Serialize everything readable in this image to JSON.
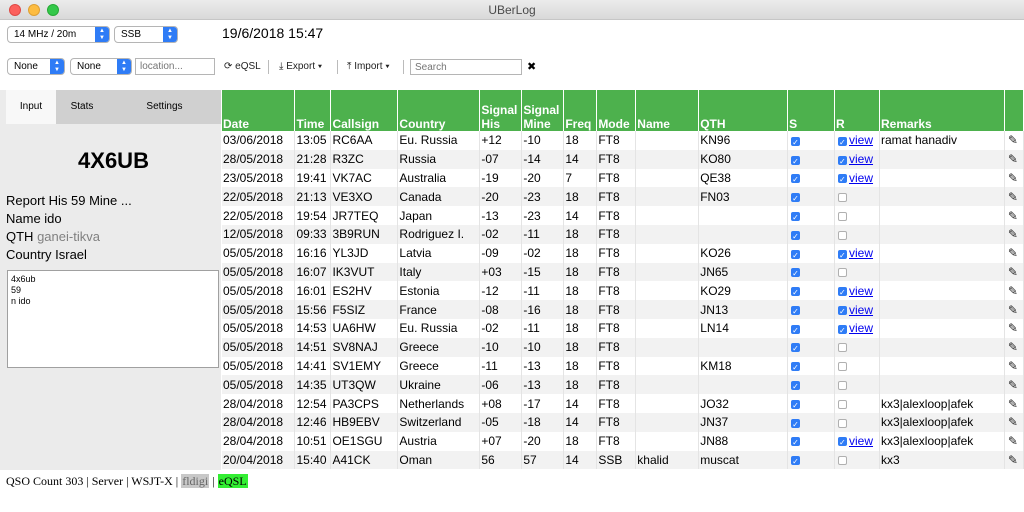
{
  "window": {
    "title": "UBerLog"
  },
  "toolbar": {
    "band": "14 MHz / 20m",
    "mode": "SSB",
    "datetime": "19/6/2018 15:47",
    "filter1": "None",
    "filter2": "None",
    "location_placeholder": "location...",
    "eqsl_label": "eQSL",
    "export_label": "Export",
    "import_label": "Import",
    "search_placeholder": "Search"
  },
  "tabs": [
    "Input",
    "Stats",
    "Settings"
  ],
  "input": {
    "callsign": "4X6UB",
    "report_line": "Report His 59 Mine ...",
    "name_line": "Name ido",
    "qth_label": "QTH",
    "qth_value": "ganei-tikva",
    "country_line": "Country Israel",
    "memo": "4x6ub\n59\nn ido"
  },
  "table": {
    "headers": [
      "Date",
      "Time",
      "Callsign",
      "Country",
      "Signal His",
      "Signal Mine",
      "Freq",
      "Mode",
      "Name",
      "QTH",
      "S",
      "R",
      "Remarks",
      ""
    ],
    "view_label": "view",
    "rows": [
      [
        "03/06/2018",
        "13:05",
        "RC6AA",
        "Eu. Russia",
        "+12",
        "-10",
        "18",
        "FT8",
        "",
        "KN96",
        true,
        true,
        "ramat hanadiv"
      ],
      [
        "28/05/2018",
        "21:28",
        "R3ZC",
        "Russia",
        "-07",
        "-14",
        "14",
        "FT8",
        "",
        "KO80",
        true,
        true,
        ""
      ],
      [
        "23/05/2018",
        "19:41",
        "VK7AC",
        "Australia",
        "-19",
        "-20",
        "7",
        "FT8",
        "",
        "QE38",
        true,
        true,
        ""
      ],
      [
        "22/05/2018",
        "21:13",
        "VE3XO",
        "Canada",
        "-20",
        "-23",
        "18",
        "FT8",
        "",
        "FN03",
        true,
        false,
        ""
      ],
      [
        "22/05/2018",
        "19:54",
        "JR7TEQ",
        "Japan",
        "-13",
        "-23",
        "14",
        "FT8",
        "",
        "",
        true,
        false,
        ""
      ],
      [
        "12/05/2018",
        "09:33",
        "3B9RUN",
        "Rodriguez I.",
        "-02",
        "-11",
        "18",
        "FT8",
        "",
        "",
        true,
        false,
        ""
      ],
      [
        "05/05/2018",
        "16:16",
        "YL3JD",
        "Latvia",
        "-09",
        "-02",
        "18",
        "FT8",
        "",
        "KO26",
        true,
        true,
        ""
      ],
      [
        "05/05/2018",
        "16:07",
        "IK3VUT",
        "Italy",
        "+03",
        "-15",
        "18",
        "FT8",
        "",
        "JN65",
        true,
        false,
        ""
      ],
      [
        "05/05/2018",
        "16:01",
        "ES2HV",
        "Estonia",
        "-12",
        "-11",
        "18",
        "FT8",
        "",
        "KO29",
        true,
        true,
        ""
      ],
      [
        "05/05/2018",
        "15:56",
        "F5SIZ",
        "France",
        "-08",
        "-16",
        "18",
        "FT8",
        "",
        "JN13",
        true,
        true,
        ""
      ],
      [
        "05/05/2018",
        "14:53",
        "UA6HW",
        "Eu. Russia",
        "-02",
        "-11",
        "18",
        "FT8",
        "",
        "LN14",
        true,
        true,
        ""
      ],
      [
        "05/05/2018",
        "14:51",
        "SV8NAJ",
        "Greece",
        "-10",
        "-10",
        "18",
        "FT8",
        "",
        "",
        true,
        false,
        ""
      ],
      [
        "05/05/2018",
        "14:41",
        "SV1EMY",
        "Greece",
        "-11",
        "-13",
        "18",
        "FT8",
        "",
        "KM18",
        true,
        false,
        ""
      ],
      [
        "05/05/2018",
        "14:35",
        "UT3QW",
        "Ukraine",
        "-06",
        "-13",
        "18",
        "FT8",
        "",
        "",
        true,
        false,
        ""
      ],
      [
        "28/04/2018",
        "12:54",
        "PA3CPS",
        "Netherlands",
        "+08",
        "-17",
        "14",
        "FT8",
        "",
        "JO32",
        true,
        false,
        "kx3|alexloop|afek"
      ],
      [
        "28/04/2018",
        "12:46",
        "HB9EBV",
        "Switzerland",
        "-05",
        "-18",
        "14",
        "FT8",
        "",
        "JN37",
        true,
        false,
        "kx3|alexloop|afek"
      ],
      [
        "28/04/2018",
        "10:51",
        "OE1SGU",
        "Austria",
        "+07",
        "-20",
        "18",
        "FT8",
        "",
        "JN88",
        true,
        true,
        "kx3|alexloop|afek"
      ],
      [
        "20/04/2018",
        "15:40",
        "A41CK",
        "Oman",
        "56",
        "57",
        "14",
        "SSB",
        "khalid",
        "muscat",
        true,
        false,
        "kx3"
      ]
    ]
  },
  "status": {
    "qso_count": "QSO Count 303 | Server | WSJT-X |",
    "fldigi": "fldigi",
    "sep": "|",
    "eqsl": "eQSL"
  }
}
